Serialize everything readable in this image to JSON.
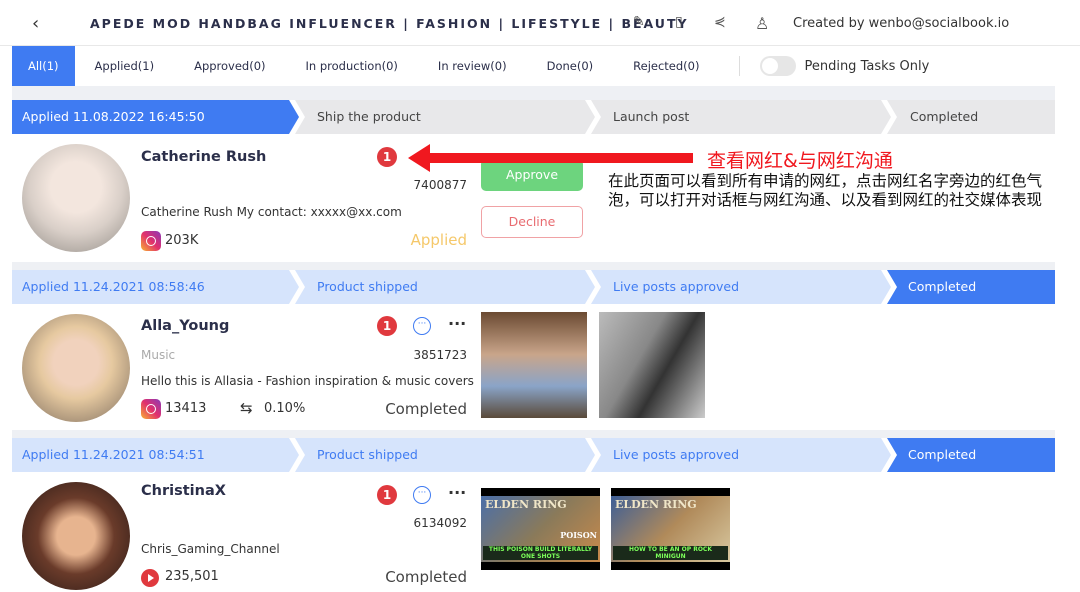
{
  "header": {
    "title": "APEDE MOD HANDBAG INFLUENCER | FASHION | LIFESTYLE | BEAUTY",
    "creator": "Created by wenbo@socialbook.io"
  },
  "tabs": [
    {
      "label": "All(1)"
    },
    {
      "label": "Applied(1)"
    },
    {
      "label": "Approved(0)"
    },
    {
      "label": "In production(0)"
    },
    {
      "label": "In review(0)"
    },
    {
      "label": "Done(0)"
    },
    {
      "label": "Rejected(0)"
    }
  ],
  "pending_toggle": {
    "label": "Pending Tasks Only",
    "on": false
  },
  "rows": [
    {
      "steps": [
        "Applied 11.08.2022 16:45:50",
        "Ship the product",
        "Launch post",
        "Completed"
      ],
      "name": "Catherine Rush",
      "badge": "1",
      "number": "7400877",
      "bio": "Catherine Rush My contact: xxxxx@xx.com",
      "platform": "instagram",
      "followers": "203K",
      "status": "Applied",
      "approve": "Approve",
      "decline": "Decline"
    },
    {
      "steps": [
        "Applied 11.24.2021 08:58:46",
        "Product shipped",
        "Live posts approved",
        "Completed"
      ],
      "name": "Alla_Young",
      "badge": "1",
      "category": "Music",
      "number": "3851723",
      "bio": "Hello this is Allasia - Fashion inspiration & music covers",
      "platform": "instagram",
      "followers": "13413",
      "engagement": "0.10%",
      "status": "Completed"
    },
    {
      "steps": [
        "Applied 11.24.2021 08:54:51",
        "Product shipped",
        "Live posts approved",
        "Completed"
      ],
      "name": "ChristinaX",
      "badge": "1",
      "number": "6134092",
      "bio": "Chris_Gaming_Channel",
      "platform": "youtube",
      "followers": "235,501",
      "status": "Completed",
      "thumbs": [
        {
          "brand": "ELDEN RING",
          "tag": "POISON",
          "caption": "THIS POISON BUILD LITERALLY ONE SHOTS"
        },
        {
          "brand": "ELDEN RING",
          "caption": "HOW TO BE AN OP ROCK MINIGUN"
        }
      ]
    }
  ],
  "annotation": {
    "title": "查看网红&与网红沟通",
    "body": "在此页面可以看到所有申请的网红，点击网红名字旁边的红色气泡，可以打开对话框与网红沟通、以及看到网红的社交媒体表现"
  },
  "colors": {
    "primary": "#3f7bf2",
    "badge": "#e0393e",
    "approve": "#6dd47e",
    "applied": "#f5c86a",
    "annotation": "#f0181f"
  }
}
